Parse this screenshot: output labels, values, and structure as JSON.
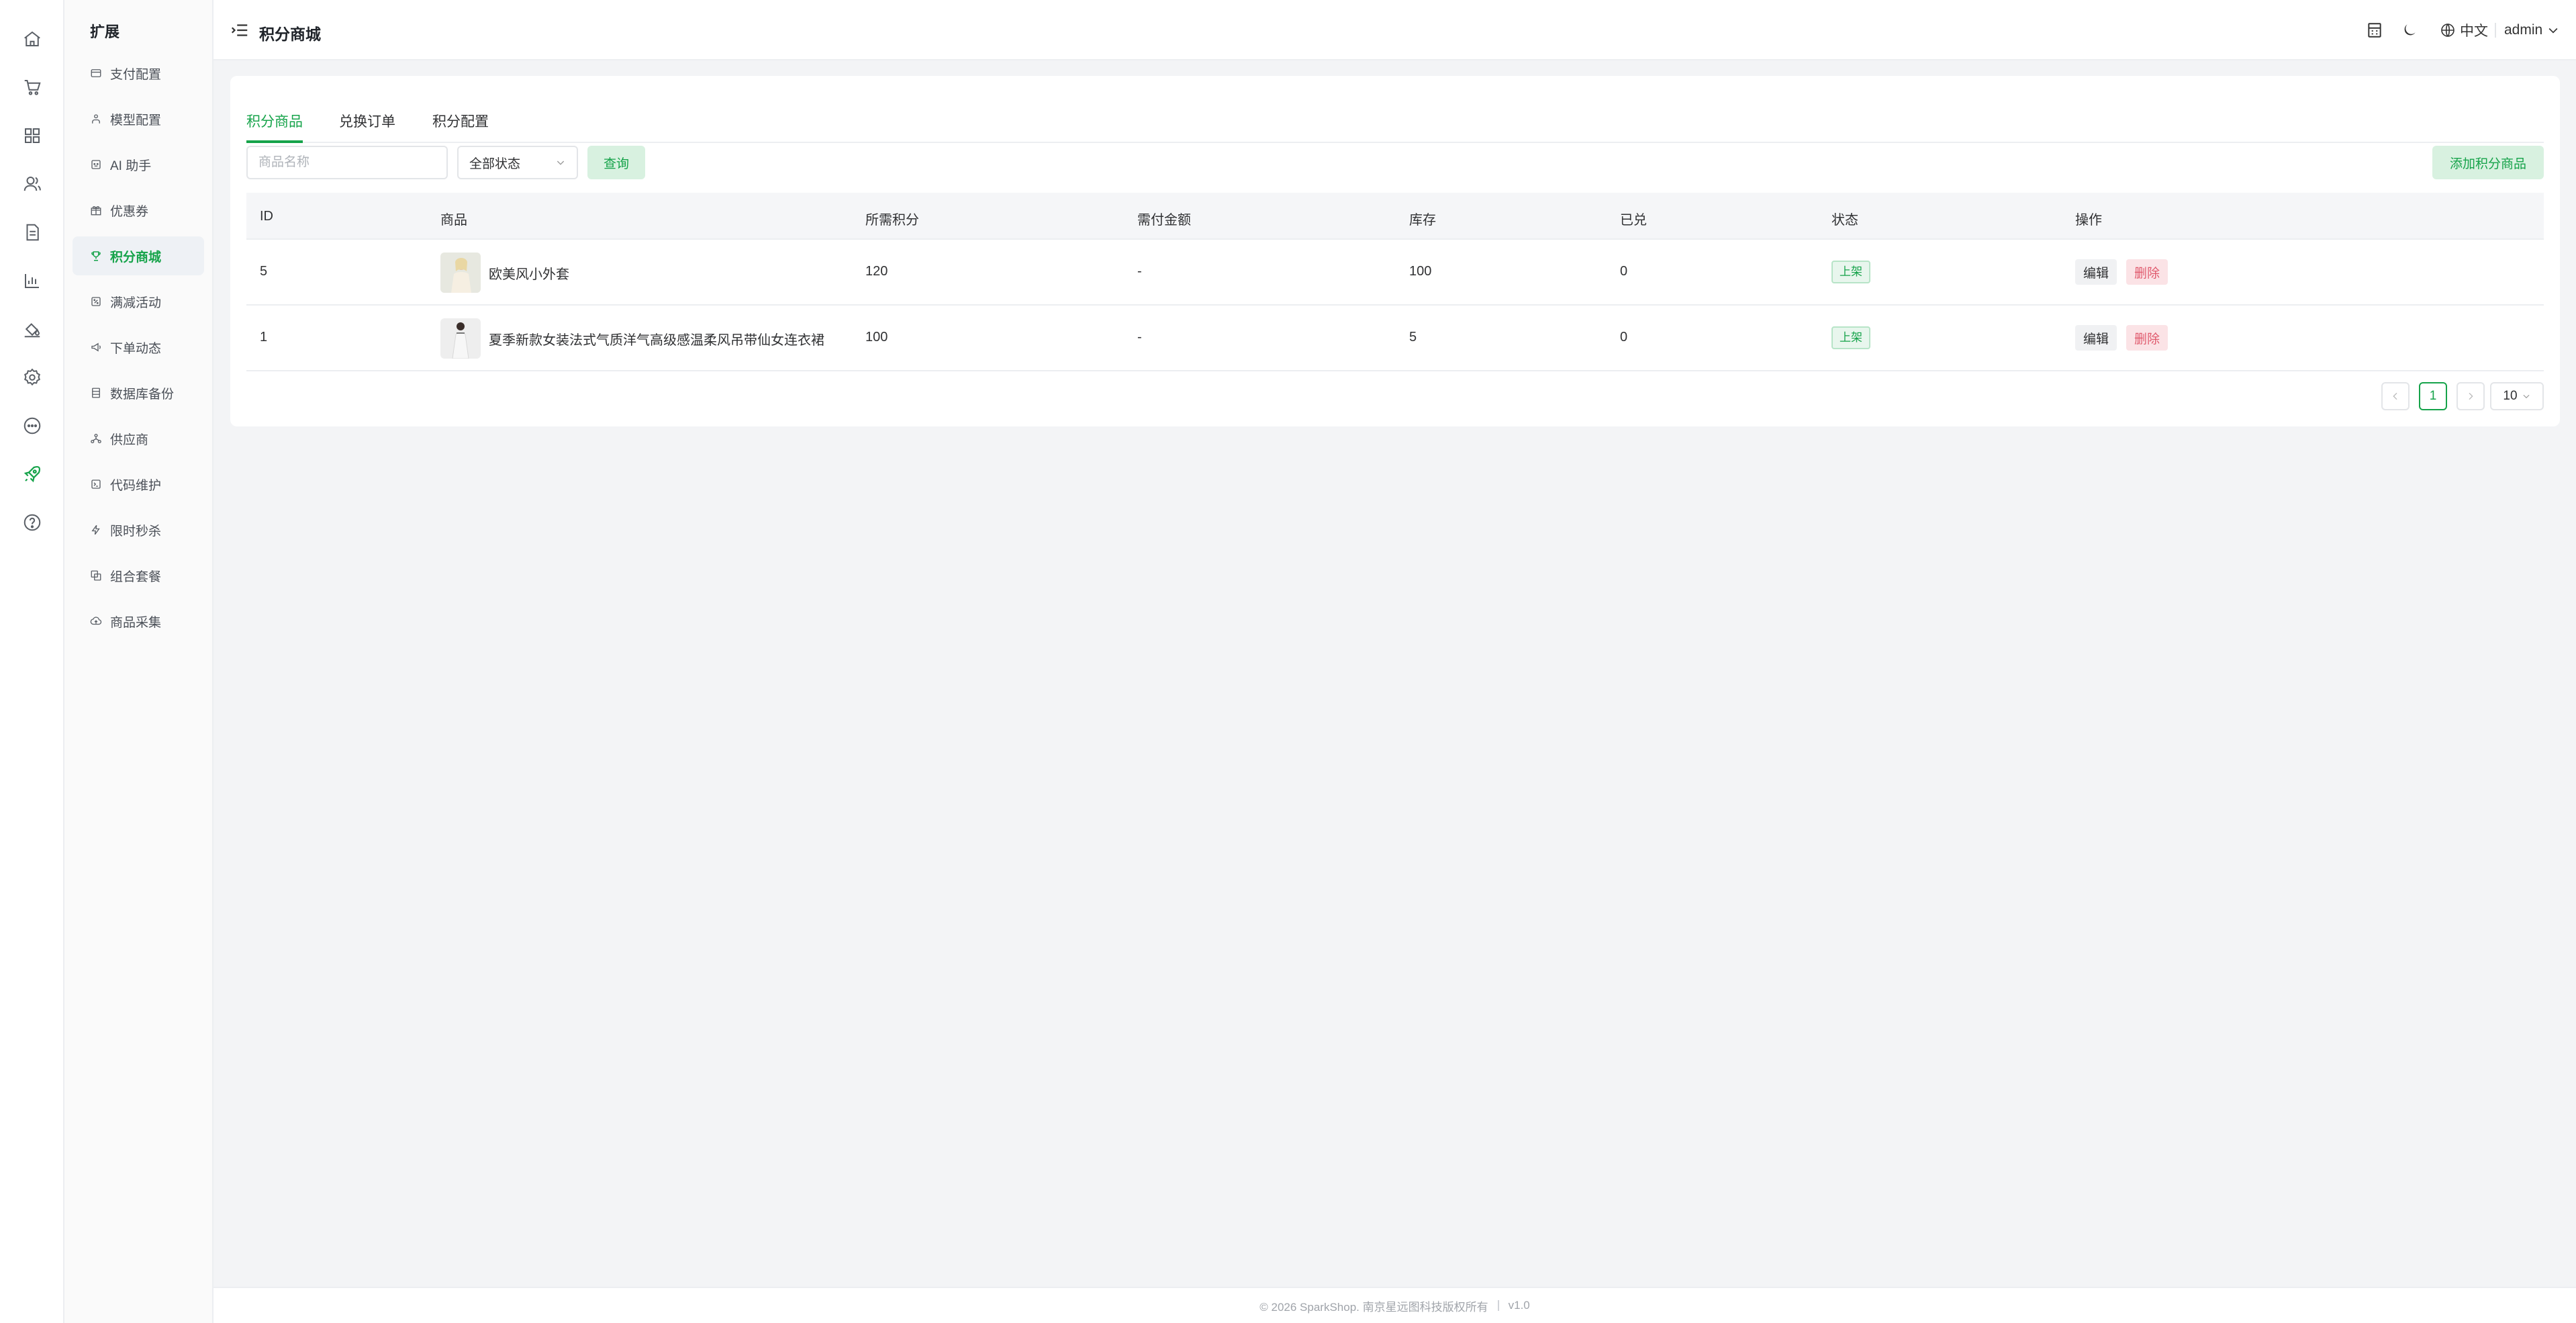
{
  "rail": {
    "items": [
      {
        "icon": "home-icon"
      },
      {
        "icon": "cart-icon"
      },
      {
        "icon": "grid-icon"
      },
      {
        "icon": "users-icon"
      },
      {
        "icon": "document-icon"
      },
      {
        "icon": "chart-icon"
      },
      {
        "icon": "paint-bucket-icon"
      },
      {
        "icon": "gear-icon"
      },
      {
        "icon": "chat-icon"
      },
      {
        "icon": "rocket-icon"
      },
      {
        "icon": "help-icon"
      }
    ],
    "active_color": "#16a34a"
  },
  "submenu": {
    "title": "扩展",
    "items": [
      {
        "label": "支付配置",
        "icon": "card-icon"
      },
      {
        "label": "模型配置",
        "icon": "model-icon"
      },
      {
        "label": "AI 助手",
        "icon": "ai-icon"
      },
      {
        "label": "优惠券",
        "icon": "gift-icon"
      },
      {
        "label": "积分商城",
        "icon": "trophy-icon"
      },
      {
        "label": "满减活动",
        "icon": "discount-icon"
      },
      {
        "label": "下单动态",
        "icon": "megaphone-icon"
      },
      {
        "label": "数据库备份",
        "icon": "database-icon"
      },
      {
        "label": "供应商",
        "icon": "supplier-icon"
      },
      {
        "label": "代码维护",
        "icon": "code-icon"
      },
      {
        "label": "限时秒杀",
        "icon": "flash-icon"
      },
      {
        "label": "组合套餐",
        "icon": "bundle-icon"
      },
      {
        "label": "商品采集",
        "icon": "cloud-icon"
      }
    ]
  },
  "header": {
    "title": "积分商城",
    "language": "中文",
    "user": "admin"
  },
  "tabs": [
    "积分商品",
    "兑换订单",
    "积分配置"
  ],
  "filters": {
    "name_placeholder": "商品名称",
    "status_value": "全部状态",
    "query_label": "查询",
    "add_label": "添加积分商品"
  },
  "table": {
    "columns": [
      "ID",
      "商品",
      "所需积分",
      "需付金额",
      "库存",
      "已兑",
      "状态",
      "操作"
    ],
    "rows": [
      {
        "id": "5",
        "name": "欧美风小外套",
        "points": "120",
        "price": "-",
        "stock": "100",
        "redeemed": "0",
        "status": "上架",
        "edit": "编辑",
        "delete": "删除"
      },
      {
        "id": "1",
        "name": "夏季新款女装法式气质洋气高级感温柔风吊带仙女连衣裙",
        "points": "100",
        "price": "-",
        "stock": "5",
        "redeemed": "0",
        "status": "上架",
        "edit": "编辑",
        "delete": "删除"
      }
    ]
  },
  "pagination": {
    "current": "1",
    "page_size": "10"
  },
  "footer": {
    "copyright": "© 2026 SparkShop. 南京星远图科技版权所有",
    "version": "v1.0"
  },
  "colors": {
    "accent": "#16a34a",
    "danger": "#e05a6d",
    "background": "#f3f4f6"
  }
}
